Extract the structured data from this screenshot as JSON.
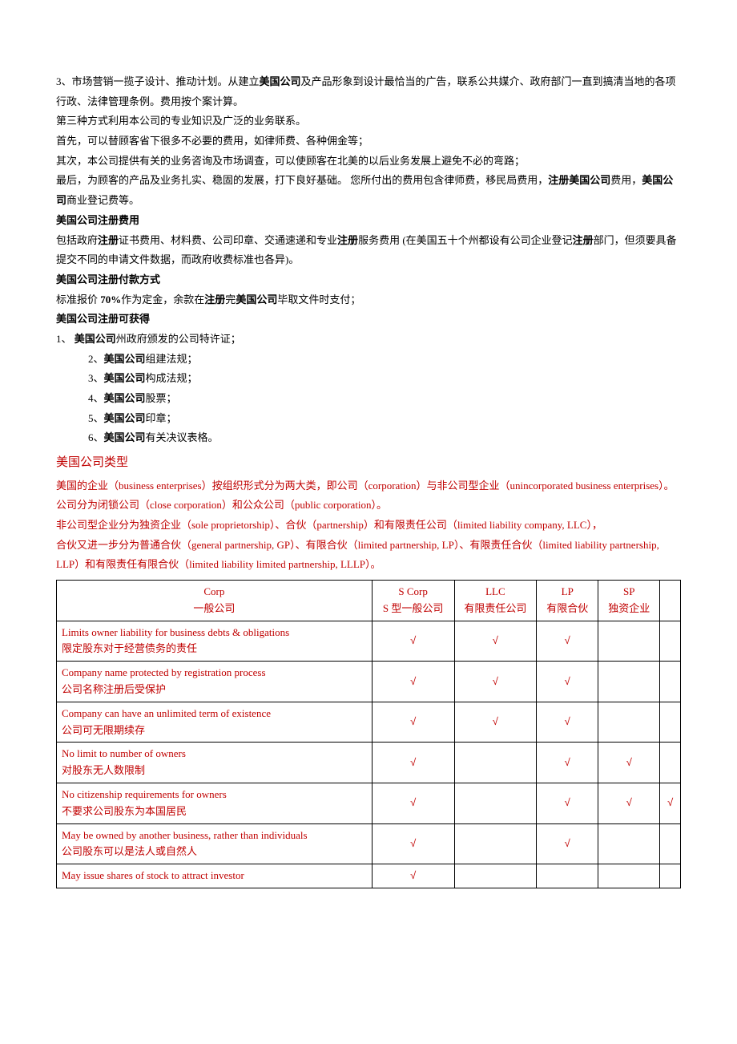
{
  "paragraphs": {
    "p1_a": "3、市场营销一揽子设计、推动计划。从建立",
    "p1_b": "美国公司",
    "p1_c": "及产品形象到设计最恰当的广告，联系公共媒介、政府部门一直到搞清当地的各项行政、法律管理条例。费用按个案计算。",
    "p2": "第三种方式利用本公司的专业知识及广泛的业务联系。",
    "p3": "首先，可以替顾客省下很多不必要的费用，如律师费、各种佣金等；",
    "p4": "其次，本公司提供有关的业务咨询及市场调查，可以使顾客在北美的以后业务发展上避免不必的弯路；",
    "p5_a": "最后，为顾客的产品及业务扎实、稳固的发展，打下良好基础。 您所付出的费用包含律师费，移民局费用，",
    "p5_b": "注册美国公司",
    "p5_c": "费用，",
    "p5_d": "美国公司",
    "p5_e": "商业登记费等。",
    "h1": "美国公司注册费用",
    "p6_a": "包括政府",
    "p6_b": "注册",
    "p6_c": "证书费用、材料费、公司印章、交通速递和专业",
    "p6_d": "注册",
    "p6_e": "服务费用 (在美国五十个州都设有公司企业登记",
    "p6_f": "注册",
    "p6_g": "部门，但须要具备提交不同的申请文件数据，而政府收费标准也各异)。",
    "h2": "美国公司注册付款方式",
    "p7_a": "标准报价 ",
    "p7_b": "70%",
    "p7_c": "作为定金，余款在",
    "p7_d": "注册",
    "p7_e": "完",
    "p7_f": "美国公司",
    "p7_g": "毕取文件时支付；",
    "h3": "美国公司注册可获得",
    "list": {
      "i1_a": "1、 ",
      "i1_b": "美国公司",
      "i1_c": "州政府颁发的公司特许证；",
      "i2_a": "2、",
      "i2_b": "美国公司",
      "i2_c": "组建法规；",
      "i3_a": "3、",
      "i3_b": "美国公司",
      "i3_c": "构成法规；",
      "i4_a": "4、",
      "i4_b": "美国公司",
      "i4_c": "股票；",
      "i5_a": "5、",
      "i5_b": "美国公司",
      "i5_c": "印章；",
      "i6_a": "6、",
      "i6_b": "美国公司",
      "i6_c": "有关决议表格。"
    },
    "h4": "美国公司类型",
    "r1": "美国的企业（business enterprises）按组织形式分为两大类，即公司（corporation）与非公司型企业（unincorporated business enterprises）。",
    "r2": "公司分为闭锁公司（close corporation）和公众公司（public corporation）。",
    "r3": "非公司型企业分为独资企业（sole proprietorship）、合伙（partnership）和有限责任公司（limited liability company, LLC），",
    "r4": "合伙又进一步分为普通合伙（general partnership, GP）、有限合伙（limited partnership, LP）、有限责任合伙（limited liability partnership, LLP）和有限责任有限合伙（limited liability limited partnership, LLLP）。"
  },
  "table": {
    "headers": {
      "col1_en": "Corp",
      "col1_cn": "一般公司",
      "col2_en": "S Corp",
      "col2_cn": "S 型一般公司",
      "col3_en": "LLC",
      "col3_cn": "有限责任公司",
      "col4_en": "LP",
      "col4_cn": "有限合伙",
      "col5_en": "SP",
      "col5_cn": "独资企业",
      "col6": ""
    },
    "rows": [
      {
        "en": "Limits owner liability for business debts & obligations",
        "cn": "限定股东对于经营债务的责任",
        "c2": "√",
        "c3": "√",
        "c4": "√",
        "c5": "",
        "c6": ""
      },
      {
        "en": "Company name protected by registration process",
        "cn": "公司名称注册后受保护",
        "c2": "√",
        "c3": "√",
        "c4": "√",
        "c5": "",
        "c6": ""
      },
      {
        "en": "Company can have an unlimited term of existence",
        "cn": "公司可无限期续存",
        "c2": "√",
        "c3": "√",
        "c4": "√",
        "c5": "",
        "c6": ""
      },
      {
        "en": "No limit to number of owners",
        "cn": "对股东无人数限制",
        "c2": "√",
        "c3": "",
        "c4": "√",
        "c5": "√",
        "c6": ""
      },
      {
        "en": "No citizenship requirements for owners",
        "cn": "不要求公司股东为本国居民",
        "c2": "√",
        "c3": "",
        "c4": "√",
        "c5": "√",
        "c6": "√"
      },
      {
        "en": "May be owned by another business, rather than individuals",
        "cn": "公司股东可以是法人或自然人",
        "c2": "√",
        "c3": "",
        "c4": "√",
        "c5": "",
        "c6": ""
      },
      {
        "en": "May issue shares of stock to attract investor",
        "cn": "",
        "c2": "√",
        "c3": "",
        "c4": "",
        "c5": "",
        "c6": ""
      }
    ]
  }
}
